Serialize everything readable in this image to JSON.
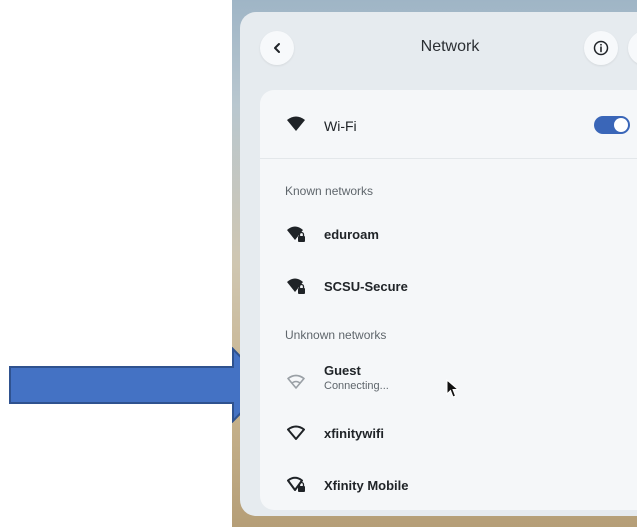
{
  "header": {
    "back_icon": "chevron-left-icon",
    "title": "Network",
    "info_icon": "info-icon",
    "settings_icon": "gear-icon"
  },
  "wifi": {
    "label": "Wi-Fi",
    "icon": "wifi-filled-icon",
    "enabled": true,
    "accent": "#3a66b8"
  },
  "known_networks": {
    "label": "Known networks",
    "items": [
      {
        "name": "eduroam",
        "icon": "wifi-locked-icon"
      },
      {
        "name": "SCSU-Secure",
        "icon": "wifi-locked-icon"
      }
    ]
  },
  "unknown_networks": {
    "label": "Unknown networks",
    "items": [
      {
        "name": "Guest",
        "status": "Connecting...",
        "icon": "wifi-outline-icon"
      },
      {
        "name": "xfinitywifi",
        "icon": "wifi-outline-icon"
      },
      {
        "name": "Xfinity Mobile",
        "icon": "wifi-outline-locked-icon"
      }
    ]
  },
  "annotation": {
    "icon": "arrow-right-icon",
    "color": "#4472c4"
  }
}
